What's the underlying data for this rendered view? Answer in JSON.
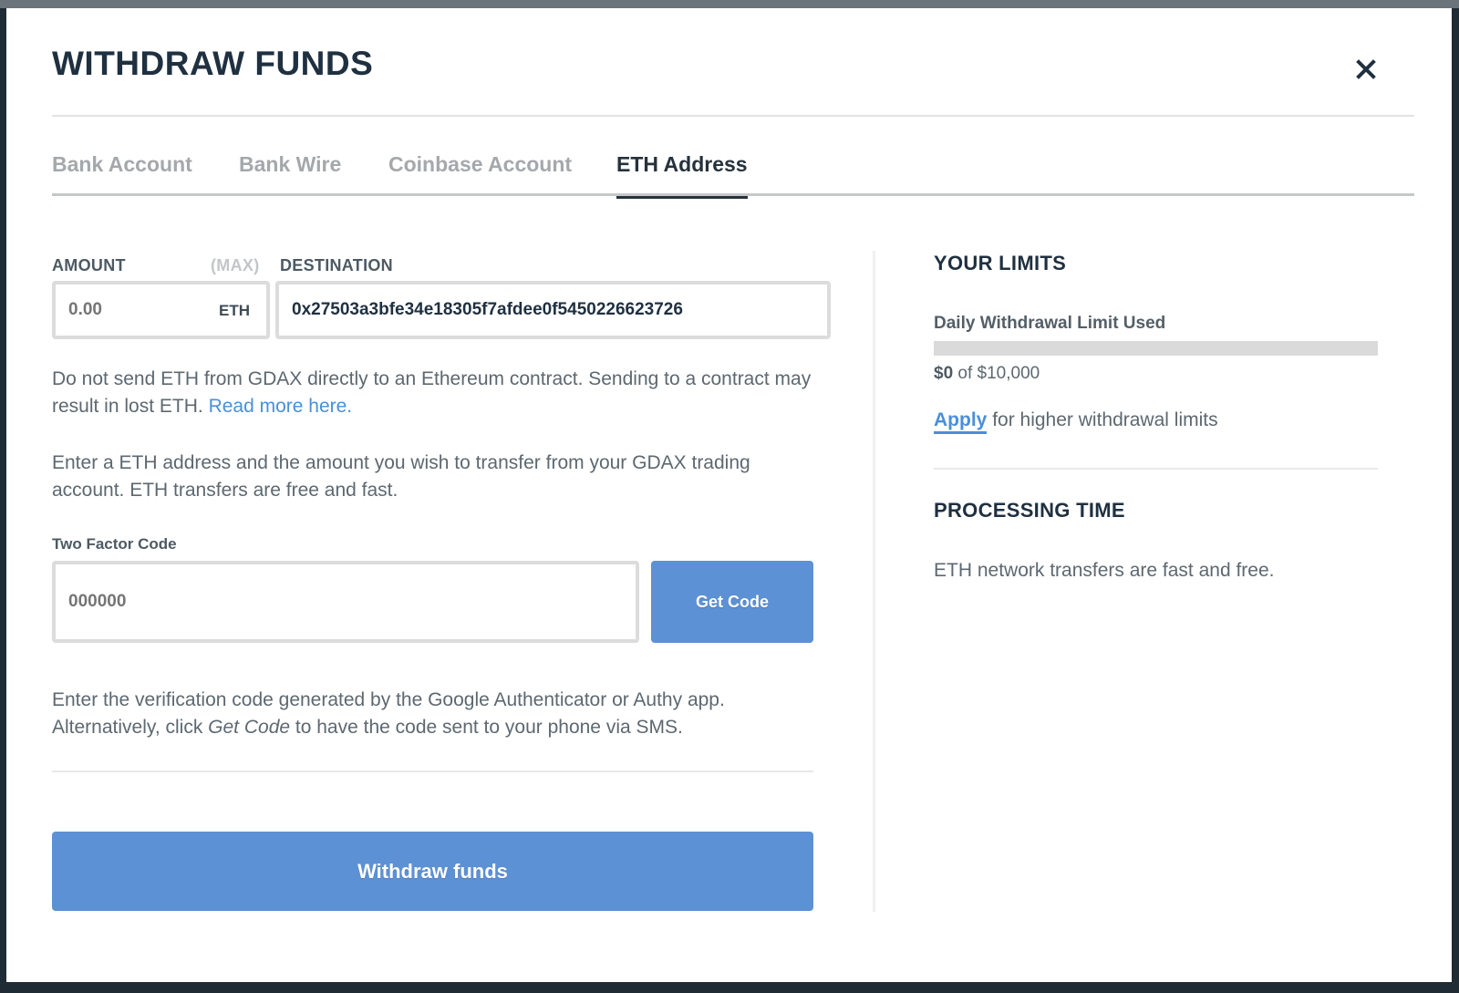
{
  "modal": {
    "title": "WITHDRAW FUNDS",
    "close_icon": "close-icon"
  },
  "tabs": [
    {
      "label": "Bank Account",
      "active": false
    },
    {
      "label": "Bank Wire",
      "active": false
    },
    {
      "label": "Coinbase Account",
      "active": false
    },
    {
      "label": "ETH Address",
      "active": true
    }
  ],
  "form": {
    "amount_label": "AMOUNT",
    "max_label": "(MAX)",
    "amount_placeholder": "0.00",
    "amount_value": "",
    "amount_unit": "ETH",
    "destination_label": "DESTINATION",
    "destination_value": "0x27503a3bfe34e18305f7afdee0f5450226623726",
    "warning_text": "Do not send ETH from GDAX directly to an Ethereum contract. Sending to a contract may result in lost ETH.",
    "warning_link": "Read more here.",
    "info_text": "Enter a ETH address and the amount you wish to transfer from your GDAX trading account. ETH transfers are free and fast.",
    "twofa_label": "Two Factor Code",
    "twofa_placeholder": "000000",
    "get_code_button": "Get Code",
    "twofa_help_prefix": "Enter the verification code generated by the Google Authenticator or Authy app. Alternatively, click",
    "twofa_help_em": "Get Code",
    "twofa_help_suffix": "to have the code sent to your phone via SMS.",
    "submit_button": "Withdraw funds"
  },
  "limits": {
    "title": "YOUR LIMITS",
    "daily_label": "Daily Withdrawal Limit Used",
    "used": "$0",
    "of_text": "of $10,000",
    "used_fraction": 0,
    "apply_link": "Apply",
    "apply_suffix": "for higher withdrawal limits"
  },
  "processing": {
    "title": "PROCESSING TIME",
    "text": "ETH network transfers are fast and free."
  },
  "colors": {
    "accent": "#5d91d5",
    "link": "#4a8fd8",
    "title": "#1f3040"
  }
}
